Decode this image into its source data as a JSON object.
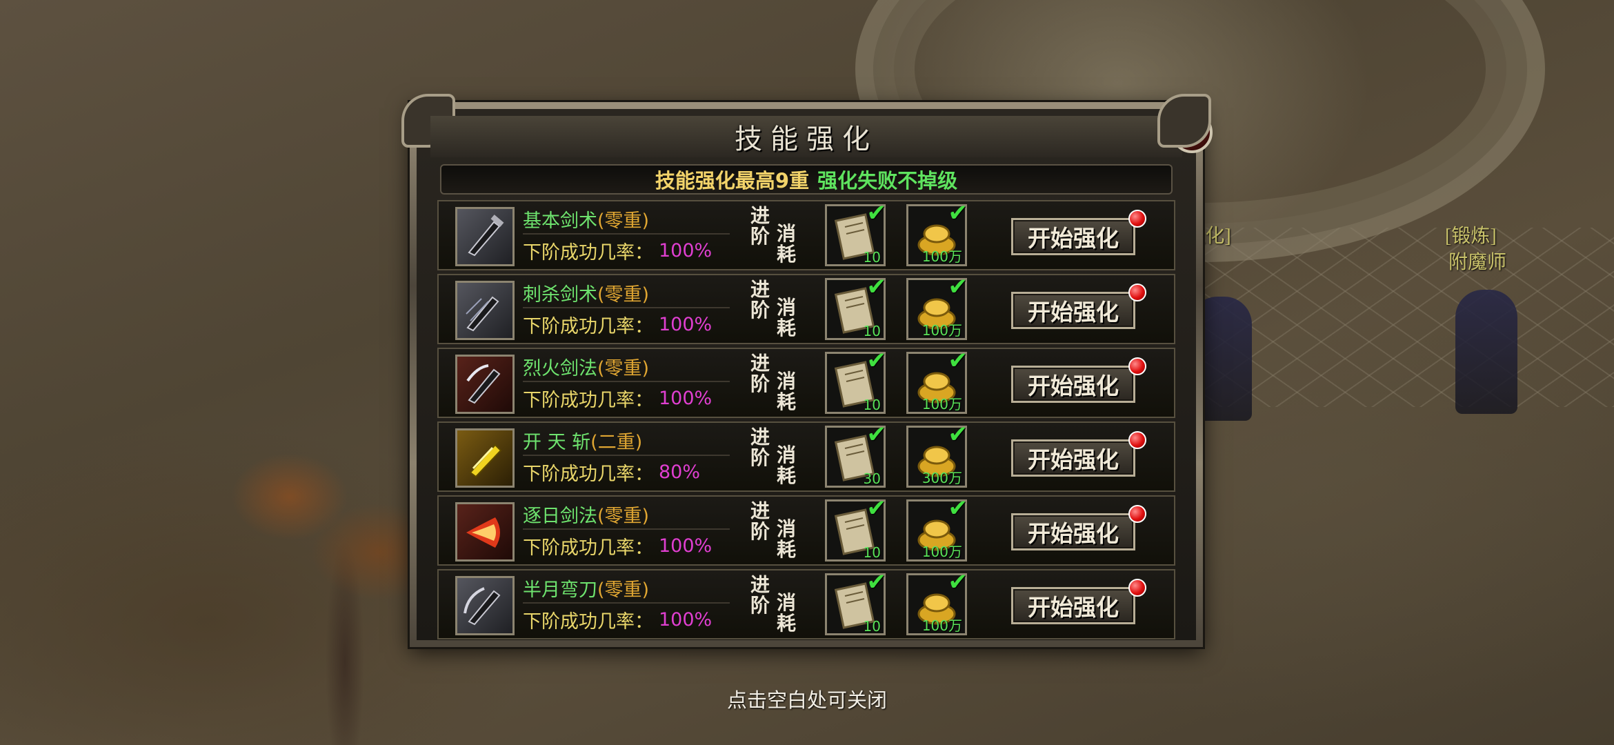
{
  "dialog": {
    "title": "技能强化",
    "notice_part1": "技能强化最高9重",
    "notice_part2": "强化失败不掉级",
    "cost_label_1": "进阶",
    "cost_label_2": "消耗",
    "start_button_label": "开始强化",
    "rate_label": "下阶成功几率："
  },
  "skills": [
    {
      "name": "基本剑术",
      "level": "(零重)",
      "rate": "100%",
      "scroll_count": "10",
      "gold_count": "100万",
      "icon": "sword-icon"
    },
    {
      "name": "刺杀剑术",
      "level": "(零重)",
      "rate": "100%",
      "scroll_count": "10",
      "gold_count": "100万",
      "icon": "thrust-sword-icon"
    },
    {
      "name": "烈火剑法",
      "level": "(零重)",
      "rate": "100%",
      "scroll_count": "10",
      "gold_count": "100万",
      "icon": "fire-sword-icon"
    },
    {
      "name": "开 天 斩",
      "level": "(二重)",
      "rate": "80%",
      "scroll_count": "30",
      "gold_count": "300万",
      "icon": "golden-slash-icon"
    },
    {
      "name": "逐日剑法",
      "level": "(零重)",
      "rate": "100%",
      "scroll_count": "10",
      "gold_count": "100万",
      "icon": "sun-fire-icon"
    },
    {
      "name": "半月弯刀",
      "level": "(零重)",
      "rate": "100%",
      "scroll_count": "10",
      "gold_count": "100万",
      "icon": "halfmoon-blade-icon"
    }
  ],
  "background": {
    "npc_left_label": "[强化]",
    "npc_right_label": "[锻炼]",
    "npc_right_title": "附魔师"
  },
  "hint": "点击空白处可关闭",
  "colors": {
    "skill_name": "#6ee36e",
    "skill_level": "#e0a632",
    "rate_label": "#e9d66a",
    "rate_value": "#e03fd1",
    "notice_yellow": "#f2d36a",
    "notice_green": "#5fe35f"
  }
}
